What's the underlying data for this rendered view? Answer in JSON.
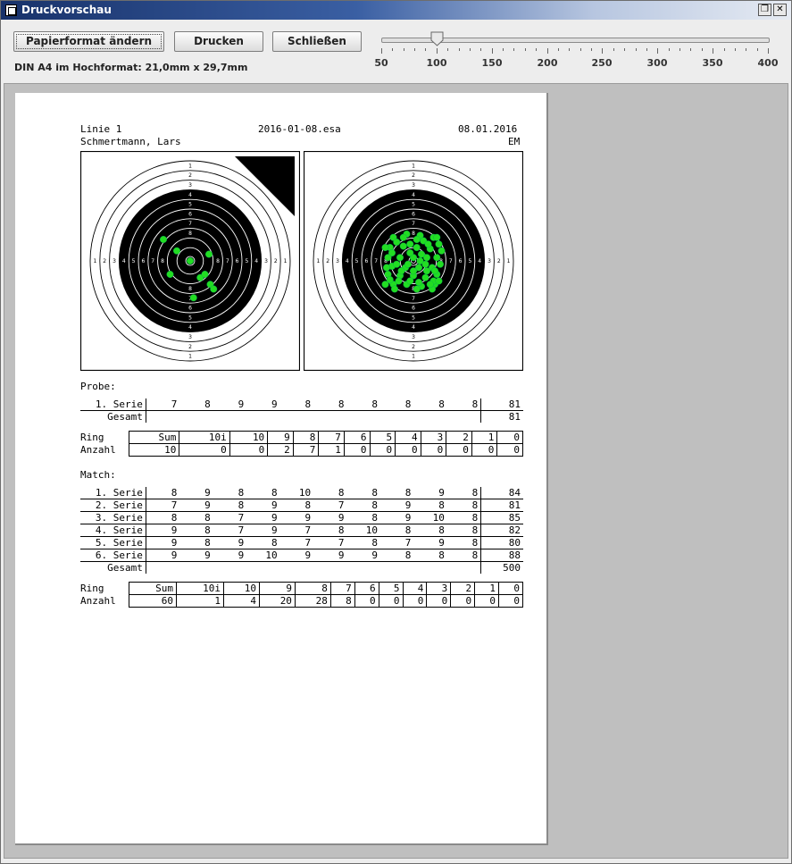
{
  "window": {
    "title": "Druckvorschau",
    "restore_icon": "restore-icon",
    "close_icon": "close-icon"
  },
  "toolbar": {
    "page_format_button": "Papierformat ändern",
    "print_button": "Drucken",
    "close_button": "Schließen",
    "format_text": "DIN A4 im Hochformat: 21,0mm x 29,7mm",
    "zoom": {
      "value": 100,
      "min": 50,
      "max": 400,
      "labels": [
        "50",
        "100",
        "150",
        "200",
        "250",
        "300",
        "350",
        "400"
      ]
    }
  },
  "page": {
    "header": {
      "line": "Linie 1",
      "file": "2016-01-08.esa",
      "date": "08.01.2016",
      "shooter": "Schmertmann, Lars",
      "discipline": "EM"
    },
    "targets": {
      "ring_labels": [
        "1",
        "2",
        "3",
        "4",
        "5",
        "6",
        "7",
        "8",
        "9",
        "10"
      ],
      "shot_color": "#22dd22",
      "probe_shots": [
        [
          0.0,
          0.0
        ],
        [
          0.3,
          0.35
        ],
        [
          0.05,
          0.55
        ],
        [
          -0.4,
          -0.32
        ],
        [
          -0.2,
          -0.15
        ],
        [
          0.28,
          -0.1
        ],
        [
          0.15,
          0.25
        ],
        [
          -0.3,
          0.2
        ],
        [
          0.35,
          0.42
        ],
        [
          0.22,
          0.2
        ]
      ],
      "match_shots": [
        [
          -0.3,
          -0.35
        ],
        [
          -0.1,
          -0.4
        ],
        [
          0.1,
          -0.38
        ],
        [
          0.3,
          -0.35
        ],
        [
          -0.35,
          -0.2
        ],
        [
          -0.15,
          -0.22
        ],
        [
          0.05,
          -0.2
        ],
        [
          0.25,
          -0.18
        ],
        [
          0.38,
          -0.25
        ],
        [
          -0.38,
          -0.05
        ],
        [
          -0.2,
          -0.05
        ],
        [
          0.0,
          -0.05
        ],
        [
          0.2,
          -0.05
        ],
        [
          0.35,
          -0.05
        ],
        [
          -0.32,
          0.08
        ],
        [
          -0.12,
          0.1
        ],
        [
          0.08,
          0.1
        ],
        [
          0.28,
          0.1
        ],
        [
          -0.38,
          0.2
        ],
        [
          -0.2,
          0.22
        ],
        [
          0.0,
          0.22
        ],
        [
          0.18,
          0.25
        ],
        [
          0.35,
          0.2
        ],
        [
          -0.3,
          0.35
        ],
        [
          -0.1,
          0.35
        ],
        [
          0.12,
          0.38
        ],
        [
          0.32,
          0.35
        ],
        [
          -0.25,
          -0.28
        ],
        [
          0.15,
          -0.3
        ],
        [
          -0.05,
          -0.12
        ],
        [
          0.3,
          0.3
        ],
        [
          -0.4,
          0.1
        ],
        [
          0.4,
          0.05
        ],
        [
          0.1,
          0.0
        ],
        [
          -0.22,
          0.3
        ],
        [
          0.22,
          -0.25
        ],
        [
          -0.05,
          0.3
        ],
        [
          0.05,
          -0.32
        ],
        [
          -0.32,
          -0.12
        ],
        [
          0.32,
          0.15
        ],
        [
          -0.15,
          -0.35
        ],
        [
          0.18,
          0.05
        ],
        [
          -0.28,
          0.42
        ],
        [
          0.05,
          0.42
        ],
        [
          0.28,
          0.42
        ],
        [
          -0.42,
          -0.2
        ],
        [
          0.42,
          -0.15
        ],
        [
          -0.08,
          0.05
        ],
        [
          0.38,
          0.3
        ],
        [
          -0.35,
          0.28
        ],
        [
          0.12,
          -0.1
        ],
        [
          -0.18,
          0.15
        ],
        [
          0.25,
          0.35
        ],
        [
          -0.05,
          -0.25
        ],
        [
          0.0,
          0.15
        ],
        [
          0.35,
          -0.35
        ],
        [
          -0.42,
          0.35
        ],
        [
          0.2,
          0.15
        ],
        [
          -0.25,
          0.05
        ],
        [
          0.08,
          0.32
        ]
      ]
    },
    "probe": {
      "label": "Probe:",
      "series": [
        {
          "name": "1. Serie",
          "values": [
            "7",
            "8",
            "9",
            "9",
            "8",
            "8",
            "8",
            "8",
            "8",
            "8"
          ],
          "total": "81"
        }
      ],
      "total_label": "Gesamt",
      "total": "81"
    },
    "probe_rings": {
      "row1_label": "Ring",
      "row2_label": "Anzahl",
      "headers": [
        "Sum",
        "10i",
        "10",
        "9",
        "8",
        "7",
        "6",
        "5",
        "4",
        "3",
        "2",
        "1",
        "0"
      ],
      "counts": [
        "10",
        "0",
        "0",
        "2",
        "7",
        "1",
        "0",
        "0",
        "0",
        "0",
        "0",
        "0",
        "0"
      ]
    },
    "match": {
      "label": "Match:",
      "series": [
        {
          "name": "1. Serie",
          "values": [
            "8",
            "9",
            "8",
            "8",
            "10",
            "8",
            "8",
            "8",
            "9",
            "8"
          ],
          "total": "84"
        },
        {
          "name": "2. Serie",
          "values": [
            "7",
            "9",
            "8",
            "9",
            "8",
            "7",
            "8",
            "9",
            "8",
            "8"
          ],
          "total": "81"
        },
        {
          "name": "3. Serie",
          "values": [
            "8",
            "8",
            "7",
            "9",
            "9",
            "9",
            "8",
            "9",
            "10",
            "8"
          ],
          "total": "85"
        },
        {
          "name": "4. Serie",
          "values": [
            "9",
            "8",
            "7",
            "9",
            "7",
            "8",
            "10",
            "8",
            "8",
            "8"
          ],
          "total": "82"
        },
        {
          "name": "5. Serie",
          "values": [
            "9",
            "8",
            "9",
            "8",
            "7",
            "7",
            "8",
            "7",
            "9",
            "8"
          ],
          "total": "80"
        },
        {
          "name": "6. Serie",
          "values": [
            "9",
            "9",
            "9",
            "10",
            "9",
            "9",
            "9",
            "8",
            "8",
            "8"
          ],
          "total": "88"
        }
      ],
      "total_label": "Gesamt",
      "total": "500"
    },
    "match_rings": {
      "row1_label": "Ring",
      "row2_label": "Anzahl",
      "headers": [
        "Sum",
        "10i",
        "10",
        "9",
        "8",
        "7",
        "6",
        "5",
        "4",
        "3",
        "2",
        "1",
        "0"
      ],
      "counts": [
        "60",
        "1",
        "4",
        "20",
        "28",
        "8",
        "0",
        "0",
        "0",
        "0",
        "0",
        "0",
        "0"
      ]
    }
  }
}
